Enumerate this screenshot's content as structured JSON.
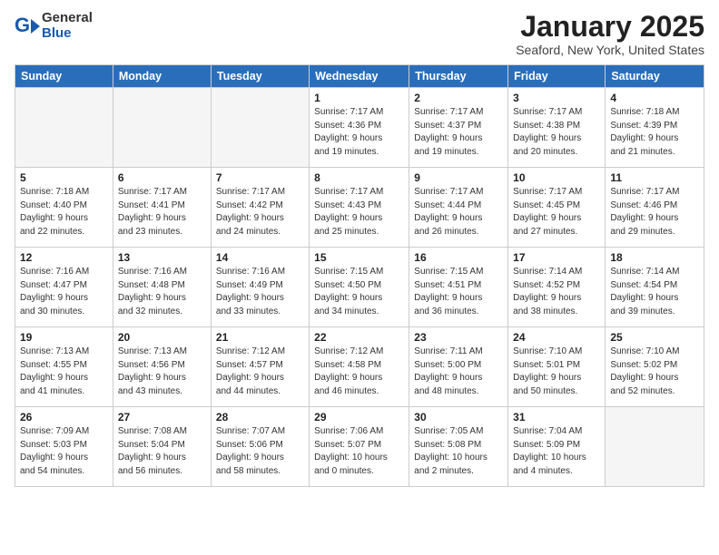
{
  "logo": {
    "general": "General",
    "blue": "Blue"
  },
  "header": {
    "month": "January 2025",
    "location": "Seaford, New York, United States"
  },
  "days_of_week": [
    "Sunday",
    "Monday",
    "Tuesday",
    "Wednesday",
    "Thursday",
    "Friday",
    "Saturday"
  ],
  "weeks": [
    [
      {
        "day": "",
        "info": ""
      },
      {
        "day": "",
        "info": ""
      },
      {
        "day": "",
        "info": ""
      },
      {
        "day": "1",
        "info": "Sunrise: 7:17 AM\nSunset: 4:36 PM\nDaylight: 9 hours\nand 19 minutes."
      },
      {
        "day": "2",
        "info": "Sunrise: 7:17 AM\nSunset: 4:37 PM\nDaylight: 9 hours\nand 19 minutes."
      },
      {
        "day": "3",
        "info": "Sunrise: 7:17 AM\nSunset: 4:38 PM\nDaylight: 9 hours\nand 20 minutes."
      },
      {
        "day": "4",
        "info": "Sunrise: 7:18 AM\nSunset: 4:39 PM\nDaylight: 9 hours\nand 21 minutes."
      }
    ],
    [
      {
        "day": "5",
        "info": "Sunrise: 7:18 AM\nSunset: 4:40 PM\nDaylight: 9 hours\nand 22 minutes."
      },
      {
        "day": "6",
        "info": "Sunrise: 7:17 AM\nSunset: 4:41 PM\nDaylight: 9 hours\nand 23 minutes."
      },
      {
        "day": "7",
        "info": "Sunrise: 7:17 AM\nSunset: 4:42 PM\nDaylight: 9 hours\nand 24 minutes."
      },
      {
        "day": "8",
        "info": "Sunrise: 7:17 AM\nSunset: 4:43 PM\nDaylight: 9 hours\nand 25 minutes."
      },
      {
        "day": "9",
        "info": "Sunrise: 7:17 AM\nSunset: 4:44 PM\nDaylight: 9 hours\nand 26 minutes."
      },
      {
        "day": "10",
        "info": "Sunrise: 7:17 AM\nSunset: 4:45 PM\nDaylight: 9 hours\nand 27 minutes."
      },
      {
        "day": "11",
        "info": "Sunrise: 7:17 AM\nSunset: 4:46 PM\nDaylight: 9 hours\nand 29 minutes."
      }
    ],
    [
      {
        "day": "12",
        "info": "Sunrise: 7:16 AM\nSunset: 4:47 PM\nDaylight: 9 hours\nand 30 minutes."
      },
      {
        "day": "13",
        "info": "Sunrise: 7:16 AM\nSunset: 4:48 PM\nDaylight: 9 hours\nand 32 minutes."
      },
      {
        "day": "14",
        "info": "Sunrise: 7:16 AM\nSunset: 4:49 PM\nDaylight: 9 hours\nand 33 minutes."
      },
      {
        "day": "15",
        "info": "Sunrise: 7:15 AM\nSunset: 4:50 PM\nDaylight: 9 hours\nand 34 minutes."
      },
      {
        "day": "16",
        "info": "Sunrise: 7:15 AM\nSunset: 4:51 PM\nDaylight: 9 hours\nand 36 minutes."
      },
      {
        "day": "17",
        "info": "Sunrise: 7:14 AM\nSunset: 4:52 PM\nDaylight: 9 hours\nand 38 minutes."
      },
      {
        "day": "18",
        "info": "Sunrise: 7:14 AM\nSunset: 4:54 PM\nDaylight: 9 hours\nand 39 minutes."
      }
    ],
    [
      {
        "day": "19",
        "info": "Sunrise: 7:13 AM\nSunset: 4:55 PM\nDaylight: 9 hours\nand 41 minutes."
      },
      {
        "day": "20",
        "info": "Sunrise: 7:13 AM\nSunset: 4:56 PM\nDaylight: 9 hours\nand 43 minutes."
      },
      {
        "day": "21",
        "info": "Sunrise: 7:12 AM\nSunset: 4:57 PM\nDaylight: 9 hours\nand 44 minutes."
      },
      {
        "day": "22",
        "info": "Sunrise: 7:12 AM\nSunset: 4:58 PM\nDaylight: 9 hours\nand 46 minutes."
      },
      {
        "day": "23",
        "info": "Sunrise: 7:11 AM\nSunset: 5:00 PM\nDaylight: 9 hours\nand 48 minutes."
      },
      {
        "day": "24",
        "info": "Sunrise: 7:10 AM\nSunset: 5:01 PM\nDaylight: 9 hours\nand 50 minutes."
      },
      {
        "day": "25",
        "info": "Sunrise: 7:10 AM\nSunset: 5:02 PM\nDaylight: 9 hours\nand 52 minutes."
      }
    ],
    [
      {
        "day": "26",
        "info": "Sunrise: 7:09 AM\nSunset: 5:03 PM\nDaylight: 9 hours\nand 54 minutes."
      },
      {
        "day": "27",
        "info": "Sunrise: 7:08 AM\nSunset: 5:04 PM\nDaylight: 9 hours\nand 56 minutes."
      },
      {
        "day": "28",
        "info": "Sunrise: 7:07 AM\nSunset: 5:06 PM\nDaylight: 9 hours\nand 58 minutes."
      },
      {
        "day": "29",
        "info": "Sunrise: 7:06 AM\nSunset: 5:07 PM\nDaylight: 10 hours\nand 0 minutes."
      },
      {
        "day": "30",
        "info": "Sunrise: 7:05 AM\nSunset: 5:08 PM\nDaylight: 10 hours\nand 2 minutes."
      },
      {
        "day": "31",
        "info": "Sunrise: 7:04 AM\nSunset: 5:09 PM\nDaylight: 10 hours\nand 4 minutes."
      },
      {
        "day": "",
        "info": ""
      }
    ]
  ]
}
